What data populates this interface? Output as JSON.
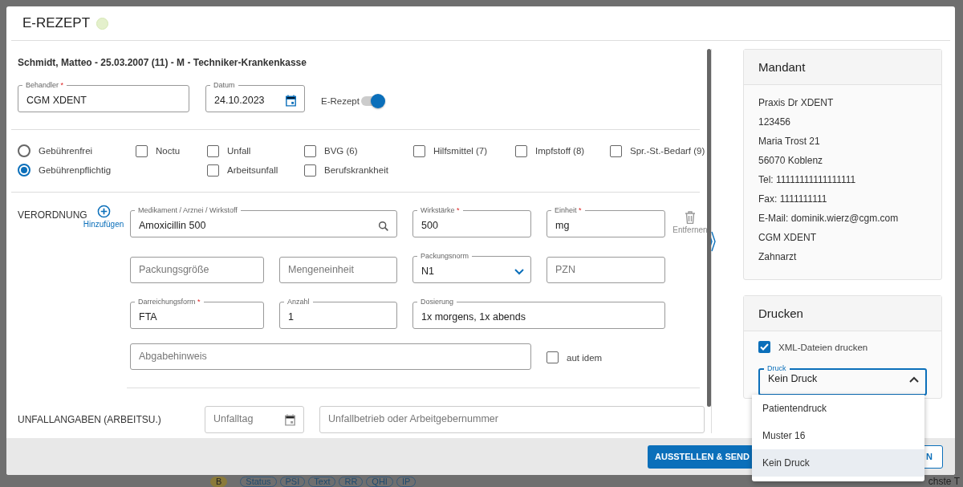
{
  "dialog": {
    "title": "E-REZEPT"
  },
  "patient": "Schmidt, Matteo - 25.03.2007 (11) - M - Techniker-Krankenkasse",
  "top_fields": [
    {
      "kind": "text",
      "label": "Behandler",
      "required": true,
      "value": "CGM XDENT"
    },
    {
      "kind": "date",
      "label": "Datum",
      "required": false,
      "value": "24.10.2023"
    }
  ],
  "erezept_toggle": {
    "label": "E-Rezept",
    "on": true
  },
  "fee_options": [
    {
      "label": "Gebührenfrei",
      "selected": false
    },
    {
      "label": "Gebührenpflichtig",
      "selected": true
    }
  ],
  "flags": [
    {
      "label": "Noctu",
      "checked": false
    },
    {
      "label": "Unfall",
      "checked": false
    },
    {
      "label": "BVG (6)",
      "checked": false
    },
    {
      "label": "Hilfsmittel (7)",
      "checked": false
    },
    {
      "label": "Impfstoff (8)",
      "checked": false
    },
    {
      "label": "Spr.-St.-Bedarf (9)",
      "checked": false
    },
    {
      "label": "Arbeitsunfall",
      "checked": false
    },
    {
      "label": "Berufskrankheit",
      "checked": false
    }
  ],
  "verordnung": {
    "label": "VERORDNUNG",
    "add_label": "Hinzufügen",
    "remove_label": "Entfernen",
    "fields": [
      {
        "kind": "search",
        "label": "Medikament / Arznei / Wirkstoff",
        "required": false,
        "value": "Amoxicillin 500"
      },
      {
        "kind": "text",
        "label": "Wirkstärke",
        "required": true,
        "value": "500"
      },
      {
        "kind": "text",
        "label": "Einheit",
        "required": true,
        "value": "mg"
      },
      {
        "kind": "text",
        "placeholder": "Packungsgröße"
      },
      {
        "kind": "text",
        "placeholder": "Mengeneinheit"
      },
      {
        "kind": "select",
        "label": "Packungsnorm",
        "required": false,
        "value": "N1"
      },
      {
        "kind": "text",
        "placeholder": "PZN"
      },
      {
        "kind": "text",
        "label": "Darreichungsform",
        "required": true,
        "value": "FTA"
      },
      {
        "kind": "text",
        "label": "Anzahl",
        "required": false,
        "value": "1"
      },
      {
        "kind": "wide",
        "label": "Dosierung",
        "required": false,
        "value": "1x morgens, 1x abends"
      },
      {
        "kind": "note",
        "placeholder": "Abgabehinweis"
      }
    ],
    "aut_idem": {
      "label": "aut idem",
      "checked": false
    }
  },
  "unfall": {
    "label": "UNFALLANGABEN (ARBEITSU.)",
    "date_placeholder": "Unfalltag",
    "company_placeholder": "Unfallbetrieb oder Arbeitgebernummer"
  },
  "mandant": {
    "title": "Mandant",
    "lines": [
      "Praxis Dr XDENT",
      "123456",
      "Maria Trost 21",
      "56070 Koblenz",
      "Tel: 11111111111111111",
      "Fax: 1111111111",
      "E-Mail: dominik.wierz@cgm.com",
      "CGM XDENT",
      "Zahnarzt"
    ]
  },
  "drucken": {
    "title": "Drucken",
    "xml": {
      "label": "XML-Dateien drucken",
      "checked": true
    },
    "select": {
      "label": "Druck",
      "value": "Kein Druck",
      "expanded": true,
      "options": [
        {
          "label": "Patientendruck",
          "selected": false
        },
        {
          "label": "Muster 16",
          "selected": false
        },
        {
          "label": "Kein Druck",
          "selected": true
        }
      ]
    }
  },
  "footer_buttons": [
    {
      "kind": "primary",
      "label": "AUSSTELLEN & SEND"
    },
    {
      "kind": "outline",
      "label": "N"
    }
  ],
  "background_chips": [
    "B",
    "Status",
    "PSI",
    "Text",
    "RR",
    "QHI",
    "IP"
  ],
  "background_text": "chste T",
  "required_mark": "*"
}
